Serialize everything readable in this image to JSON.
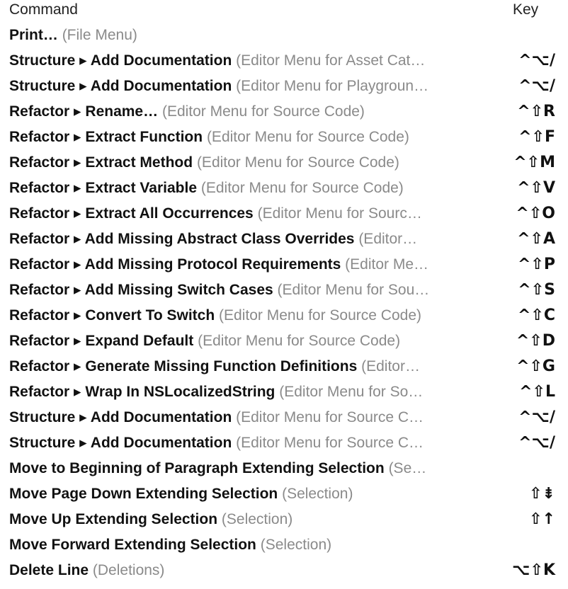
{
  "header": {
    "command_label": "Command",
    "key_label": "Key"
  },
  "rows": [
    {
      "name": "Print…",
      "context": "(File Menu)",
      "key": ""
    },
    {
      "name": "Structure ▸ Add Documentation",
      "context": "(Editor Menu for Asset Cat…",
      "key": "^⌥/"
    },
    {
      "name": "Structure ▸ Add Documentation",
      "context": "(Editor Menu for Playgroun…",
      "key": "^⌥/"
    },
    {
      "name": "Refactor ▸ Rename…",
      "context": "(Editor Menu for Source Code)",
      "key": "^⇧R"
    },
    {
      "name": "Refactor ▸ Extract Function",
      "context": "(Editor Menu for Source Code)",
      "key": "^⇧F"
    },
    {
      "name": "Refactor ▸ Extract Method",
      "context": "(Editor Menu for Source Code)",
      "key": "^⇧M"
    },
    {
      "name": "Refactor ▸ Extract Variable",
      "context": "(Editor Menu for Source Code)",
      "key": "^⇧V"
    },
    {
      "name": "Refactor ▸ Extract All Occurrences",
      "context": "(Editor Menu for Sourc…",
      "key": "^⇧O"
    },
    {
      "name": "Refactor ▸ Add Missing Abstract Class Overrides",
      "context": "(Editor…",
      "key": "^⇧A"
    },
    {
      "name": "Refactor ▸ Add Missing Protocol Requirements",
      "context": "(Editor Me…",
      "key": "^⇧P"
    },
    {
      "name": "Refactor ▸ Add Missing Switch Cases",
      "context": "(Editor Menu for Sou…",
      "key": "^⇧S"
    },
    {
      "name": "Refactor ▸ Convert To Switch",
      "context": "(Editor Menu for Source Code)",
      "key": "^⇧C"
    },
    {
      "name": "Refactor ▸ Expand Default",
      "context": "(Editor Menu for Source Code)",
      "key": "^⇧D"
    },
    {
      "name": "Refactor ▸ Generate Missing Function Definitions",
      "context": "(Editor…",
      "key": "^⇧G"
    },
    {
      "name": "Refactor ▸ Wrap In NSLocalizedString",
      "context": "(Editor Menu for So…",
      "key": "^⇧L"
    },
    {
      "name": "Structure ▸ Add Documentation",
      "context": "(Editor Menu for Source C…",
      "key": "^⌥/"
    },
    {
      "name": "Structure ▸ Add Documentation",
      "context": "(Editor Menu for Source C…",
      "key": "^⌥/"
    },
    {
      "name": "Move to Beginning of Paragraph Extending Selection",
      "context": "(Se…",
      "key": ""
    },
    {
      "name": "Move Page Down Extending Selection",
      "context": "(Selection)",
      "key": "⇧⇟"
    },
    {
      "name": "Move Up Extending Selection",
      "context": "(Selection)",
      "key": "⇧↑"
    },
    {
      "name": "Move Forward Extending Selection",
      "context": "(Selection)",
      "key": ""
    },
    {
      "name": "Delete Line",
      "context": "(Deletions)",
      "key": "⌥⇧K"
    }
  ]
}
